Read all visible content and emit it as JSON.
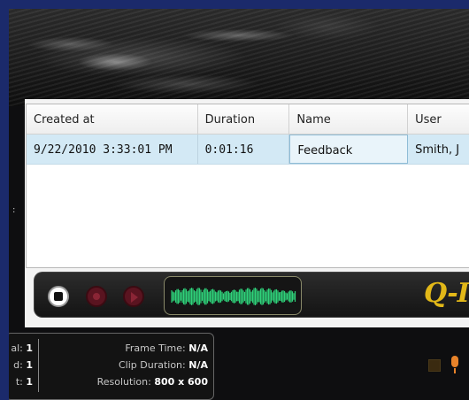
{
  "grid": {
    "headers": [
      "Created at",
      "Duration",
      "Name",
      "User"
    ],
    "rows": [
      {
        "created": "9/22/2010 3:33:01 PM",
        "duration": "0:01:16",
        "name": "Feedback",
        "user": "Smith, J"
      }
    ]
  },
  "player": {
    "brand": "Q-I",
    "waveform_color": "#2fd27a"
  },
  "info": {
    "left": [
      {
        "label": "al:",
        "value": "1"
      },
      {
        "label": "d:",
        "value": "1"
      },
      {
        "label": "t:",
        "value": "1"
      }
    ],
    "right": [
      {
        "label": "Frame Time:",
        "value": "N/A"
      },
      {
        "label": "Clip Duration:",
        "value": "N/A"
      },
      {
        "label": "Resolution:",
        "value": "800 x 600"
      }
    ]
  },
  "side_marker": ":",
  "colors": {
    "background": "#1b2a6b",
    "selection": "#d3e9f5",
    "brand": "#e2b818",
    "record": "#5a1420"
  }
}
